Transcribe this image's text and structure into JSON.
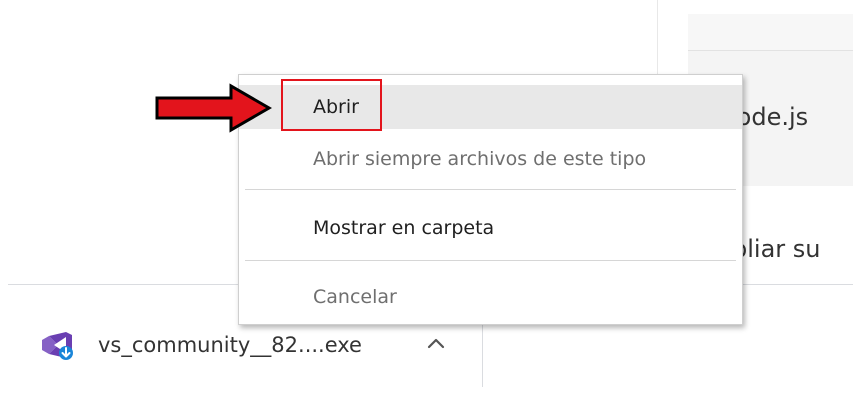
{
  "background": {
    "text_node": "lode.js",
    "text_ampliar": "pliar su"
  },
  "context_menu": {
    "items": [
      {
        "label": "Abrir",
        "state": "hovered"
      },
      {
        "label": "Abrir siempre archivos de este tipo",
        "state": "disabled"
      },
      {
        "label": "Mostrar en carpeta",
        "state": "enabled"
      },
      {
        "label": "Cancelar",
        "state": "disabled"
      }
    ]
  },
  "download_shelf": {
    "file_name": "vs_community__82....exe",
    "icon": "visual-studio-icon",
    "chevron": "chevron-up-icon"
  },
  "annotation": {
    "arrow_color": "#e3141c",
    "box_color": "#e3141c"
  }
}
